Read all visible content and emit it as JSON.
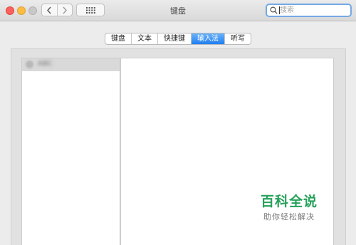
{
  "window": {
    "title": "键盘",
    "search_placeholder": "搜索"
  },
  "toolbar": {
    "back_icon": "chevron-left-icon",
    "forward_icon": "chevron-right-icon",
    "show_all_icon": "grid-icon"
  },
  "tabs": [
    {
      "label": "键盘",
      "active": false
    },
    {
      "label": "文本",
      "active": false
    },
    {
      "label": "快捷键",
      "active": false
    },
    {
      "label": "输入法",
      "active": true
    },
    {
      "label": "听写",
      "active": false
    }
  ],
  "sidebar": {
    "items": [
      {
        "label": "ABC"
      }
    ]
  },
  "watermark": {
    "title": "百科全说",
    "subtitle": "助你轻松解决"
  },
  "colors": {
    "accent": "#1f7ef1",
    "watermark_green": "#25a15a"
  }
}
